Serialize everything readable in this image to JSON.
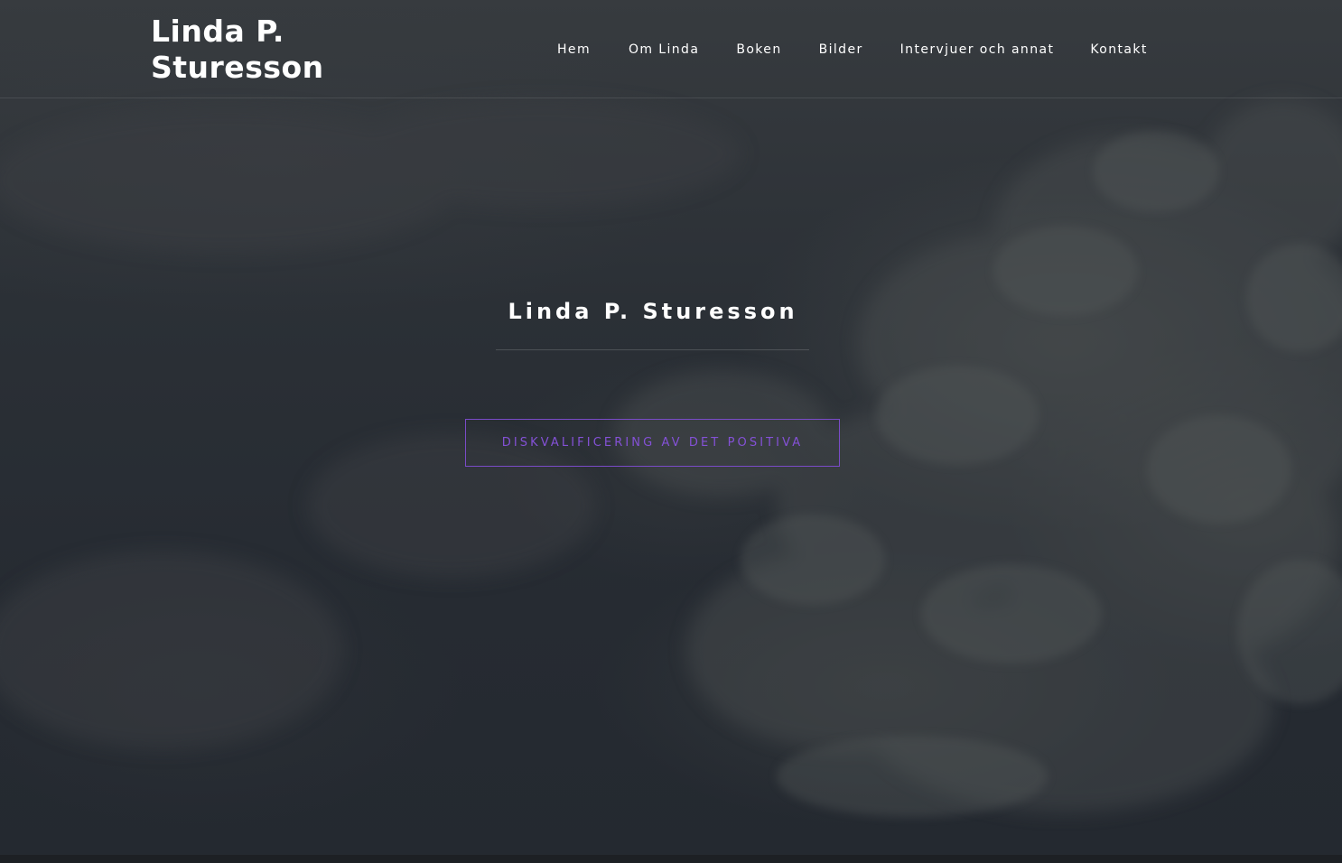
{
  "site": {
    "logo_line1": "Linda P.",
    "logo_line2": "Sturesson"
  },
  "nav": {
    "items": [
      {
        "label": "Hem"
      },
      {
        "label": "Om Linda"
      },
      {
        "label": "Boken"
      },
      {
        "label": "Bilder"
      },
      {
        "label": "Intervjuer och annat"
      },
      {
        "label": "Kontakt"
      }
    ]
  },
  "hero": {
    "title": "Linda P. Sturesson",
    "button_label": "DISKVALIFICERING AV DET POSITIVA"
  },
  "colors": {
    "accent": "#8451d6",
    "background": "#24292f",
    "text": "#ffffff"
  }
}
